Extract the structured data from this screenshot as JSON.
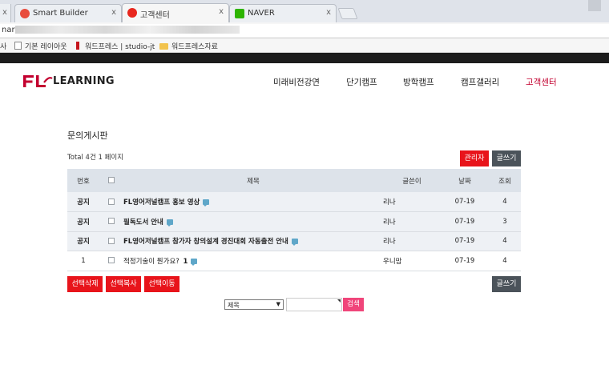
{
  "browser": {
    "tabs": [
      {
        "title": "Smart Builder",
        "favicon_color": "#e84c3d"
      },
      {
        "title": "고객센터",
        "favicon_color": "#e8271e",
        "active": true
      },
      {
        "title": "NAVER",
        "favicon_color": "#2db400"
      }
    ],
    "close_glyph": "x",
    "address_prefix": "nar",
    "bookmarks": [
      {
        "label": "기본 레이아웃",
        "icon": "page-icon"
      },
      {
        "label": "워드프레스 | studio-jt",
        "icon": "wp-icon"
      },
      {
        "label": "워드프레스자료",
        "icon": "folder-icon"
      }
    ],
    "bookmark_left_glyph": "사"
  },
  "site": {
    "logo_text": "LEARNING",
    "brand_color": "#c3002f",
    "nav": [
      "미래비전강연",
      "단기캠프",
      "방학캠프",
      "캠프갤러리",
      "고객센터"
    ],
    "active_nav": "고객센터"
  },
  "board": {
    "title": "문의게시판",
    "total_text": "Total 4건 1 페이지",
    "admin_button": "관리자",
    "write_button": "글쓰기",
    "columns": [
      "번호",
      "",
      "제목",
      "글쓴이",
      "날짜",
      "조회"
    ],
    "rows": [
      {
        "no": "공지",
        "title": "FL영어저널캠프 홍보 영상",
        "writer": "리나",
        "date": "07-19",
        "hits": "4",
        "notice": true,
        "comments": ""
      },
      {
        "no": "공지",
        "title": "필독도서 안내",
        "writer": "리나",
        "date": "07-19",
        "hits": "3",
        "notice": true,
        "comments": ""
      },
      {
        "no": "공지",
        "title": "FL영어저널캠프 참가자 창의설계 경진대회 자동출전 안내",
        "writer": "리나",
        "date": "07-19",
        "hits": "4",
        "notice": true,
        "comments": ""
      },
      {
        "no": "1",
        "title": "적정기술이 뭔가요?",
        "writer": "우니맘",
        "date": "07-19",
        "hits": "4",
        "notice": false,
        "comments": "1"
      }
    ],
    "bottom_buttons": [
      "선택삭제",
      "선택복사",
      "선택이동"
    ],
    "bottom_write": "글쓰기"
  },
  "search": {
    "field_selected": "제목",
    "query": "",
    "button": "검색"
  }
}
